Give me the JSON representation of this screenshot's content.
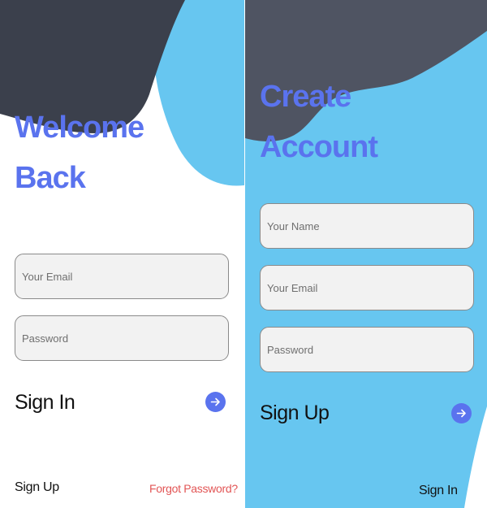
{
  "login": {
    "title_line1": "Welcome",
    "title_line2": "Back",
    "email_placeholder": "Your Email",
    "password_placeholder": "Password",
    "submit_label": "Sign In",
    "signup_link": "Sign Up",
    "forgot_link": "Forgot Password?"
  },
  "register": {
    "title_line1": "Create",
    "title_line2": "Account",
    "name_placeholder": "Your Name",
    "email_placeholder": "Your Email",
    "password_placeholder": "Password",
    "submit_label": "Sign Up",
    "signin_link": "Sign In"
  },
  "icons": {
    "submit_arrow": "arrow-right-icon"
  },
  "colors": {
    "accent": "#5a73ee",
    "dark_shape": "#3b404c",
    "dark_shape_alt": "#4f5462",
    "light_blue": "#67c6f0",
    "forgot_link": "#e25555",
    "field_bg": "#f2f2f2"
  }
}
